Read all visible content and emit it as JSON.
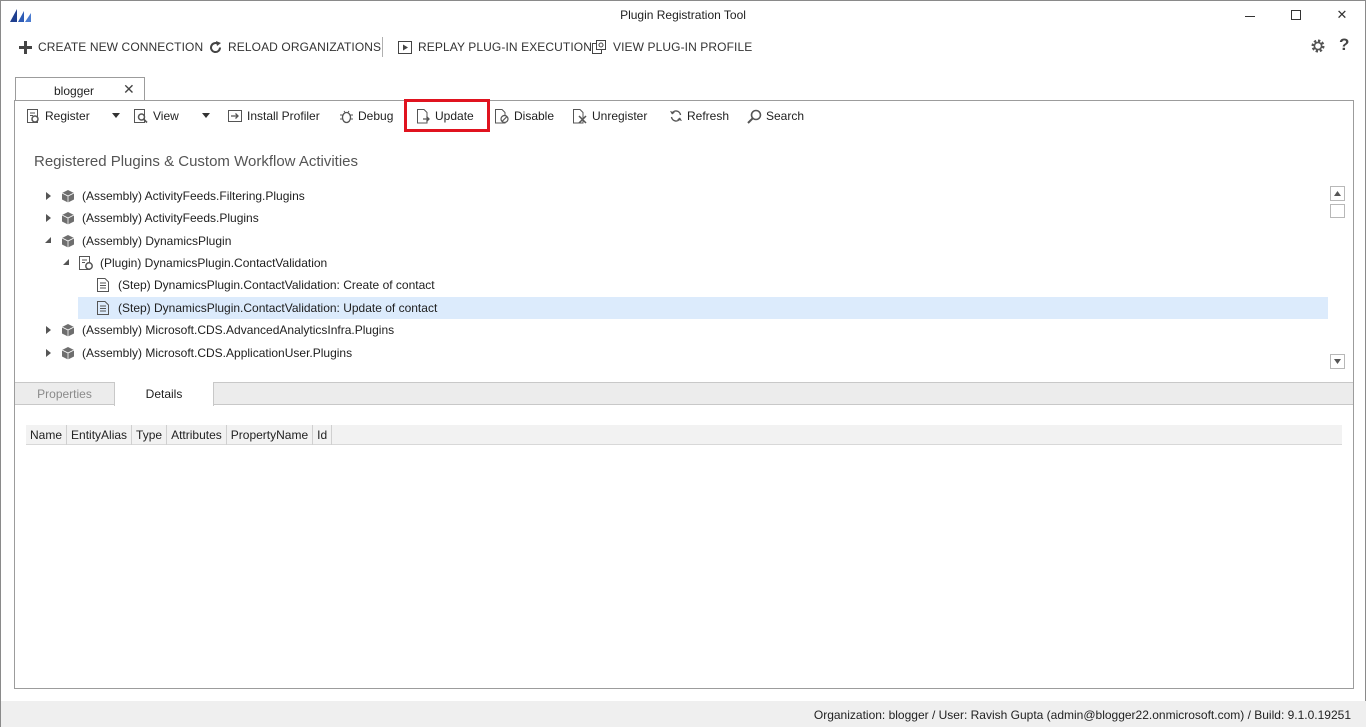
{
  "window": {
    "title": "Plugin Registration Tool"
  },
  "commandbar": {
    "create_connection": "CREATE NEW CONNECTION",
    "reload_organizations": "RELOAD ORGANIZATIONS",
    "replay_execution": "REPLAY PLUG-IN EXECUTION",
    "view_profile": "VIEW PLUG-IN PROFILE",
    "help": "?"
  },
  "connection_tab": {
    "label": "blogger",
    "close": "✕"
  },
  "toolbar": {
    "register": "Register",
    "view": "View",
    "install_profiler": "Install Profiler",
    "debug": "Debug",
    "update": "Update",
    "disable": "Disable",
    "unregister": "Unregister",
    "refresh": "Refresh",
    "search": "Search"
  },
  "section_title": "Registered Plugins & Custom Workflow Activities",
  "tree": {
    "items": [
      {
        "label": "(Assembly) ActivityFeeds.Filtering.Plugins",
        "kind": "assembly",
        "state": "collapsed"
      },
      {
        "label": "(Assembly) ActivityFeeds.Plugins",
        "kind": "assembly",
        "state": "collapsed"
      },
      {
        "label": "(Assembly) DynamicsPlugin",
        "kind": "assembly",
        "state": "expanded"
      },
      {
        "label": "(Plugin) DynamicsPlugin.ContactValidation",
        "kind": "plugin",
        "state": "expanded"
      },
      {
        "label": "(Step) DynamicsPlugin.ContactValidation: Create of contact",
        "kind": "step",
        "state": "leaf"
      },
      {
        "label": "(Step) DynamicsPlugin.ContactValidation: Update of contact",
        "kind": "step",
        "state": "leaf",
        "selected": true
      },
      {
        "label": "(Assembly) Microsoft.CDS.AdvancedAnalyticsInfra.Plugins",
        "kind": "assembly",
        "state": "collapsed"
      },
      {
        "label": "(Assembly) Microsoft.CDS.ApplicationUser.Plugins",
        "kind": "assembly",
        "state": "collapsed"
      }
    ]
  },
  "bottom_tabs": {
    "properties": "Properties",
    "details": "Details"
  },
  "details_grid": {
    "columns": [
      "Name",
      "EntityAlias",
      "Type",
      "Attributes",
      "PropertyName",
      "Id"
    ]
  },
  "statusbar": {
    "text": "Organization: blogger / User: Ravish Gupta (admin@blogger22.onmicrosoft.com) / Build: 9.1.0.19251"
  },
  "colors": {
    "highlight": "#e0131f",
    "selected_row": "#dcebfc",
    "brand_logo": "#1f3f8f"
  }
}
